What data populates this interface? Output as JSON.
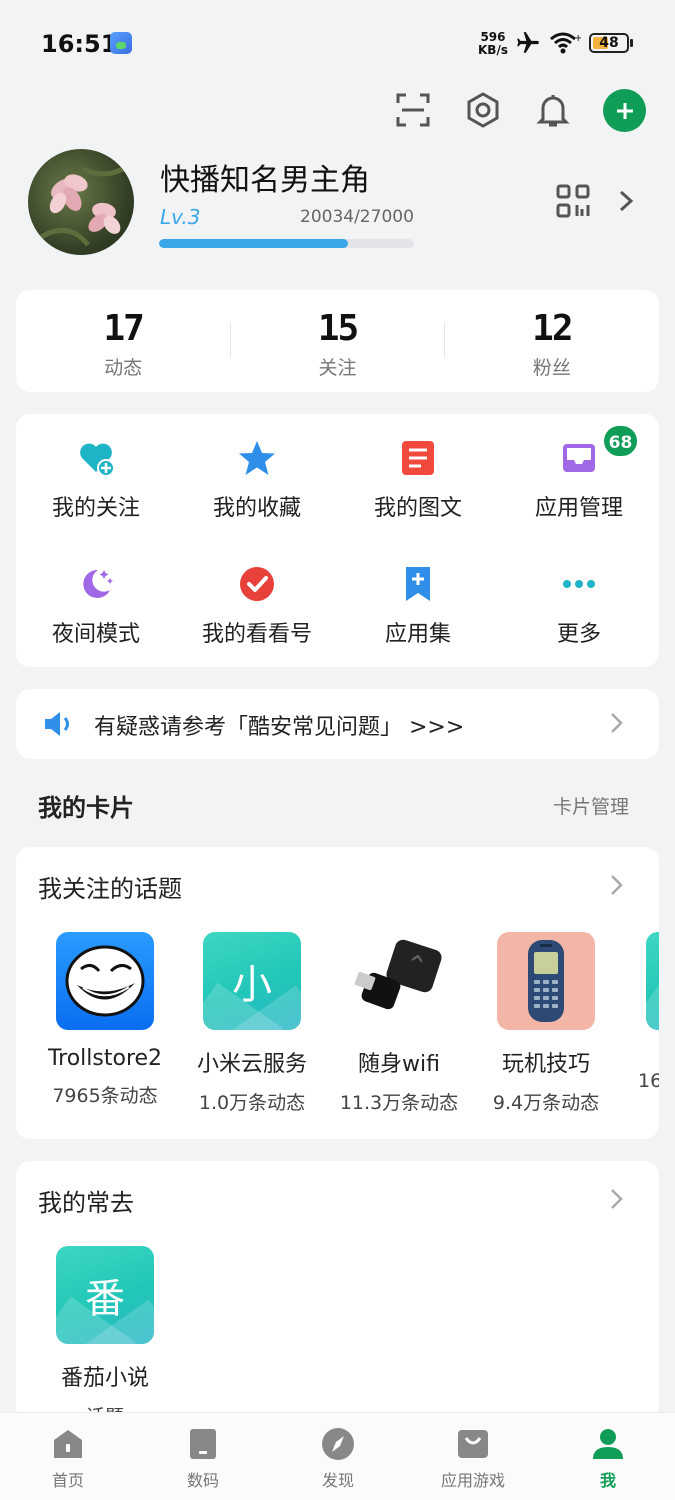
{
  "status_bar": {
    "time": "16:51",
    "net_speed_value": "596",
    "net_speed_unit": "KB/s",
    "battery": "48",
    "icons": [
      "app-icon",
      "airplane-icon",
      "wifi-icon",
      "battery-icon"
    ]
  },
  "top_icons": [
    "scan-icon",
    "settings-icon",
    "bell-icon",
    "plus-icon"
  ],
  "profile": {
    "username": "快播知名男主角",
    "level": "Lv.3",
    "exp": "20034/27000",
    "exp_progress": 0.742
  },
  "stats": [
    {
      "value": "17",
      "label": "动态"
    },
    {
      "value": "15",
      "label": "关注"
    },
    {
      "value": "12",
      "label": "粉丝"
    }
  ],
  "grid": [
    {
      "label": "我的关注",
      "icon": "heart-plus-icon",
      "color": "#1fb5c6"
    },
    {
      "label": "我的收藏",
      "icon": "star-icon",
      "color": "#2f8fe8"
    },
    {
      "label": "我的图文",
      "icon": "document-icon",
      "color": "#ef4a3c"
    },
    {
      "label": "应用管理",
      "icon": "inbox-icon",
      "color": "#a067e6"
    },
    {
      "label": "夜间模式",
      "icon": "moon-icon",
      "color": "#a067e6"
    },
    {
      "label": "我的看看号",
      "icon": "check-circle-icon",
      "color": "#e8403a"
    },
    {
      "label": "应用集",
      "icon": "bookmark-plus-icon",
      "color": "#2f8fe8"
    },
    {
      "label": "更多",
      "icon": "more-icon",
      "color": "#1fb5c6"
    }
  ],
  "app_manage_badge": "68",
  "notice": {
    "text": "有疑惑请参考「酷安常见问题」 >>>",
    "icon": "speaker-icon"
  },
  "cards_section": {
    "title": "我的卡片",
    "action": "卡片管理"
  },
  "followed_topics": {
    "title": "我关注的话题",
    "items": [
      {
        "name": "Trollstore2",
        "count": "7965条动态",
        "tile": "trollface"
      },
      {
        "name": "小米云服务",
        "count": "1.0万条动态",
        "tile_char": "小"
      },
      {
        "name": "随身wifi",
        "count": "11.3万条动态",
        "tile": "usb-wifi"
      },
      {
        "name": "玩机技巧",
        "count": "9.4万条动态",
        "tile": "phone"
      },
      {
        "name": "",
        "count": "16",
        "tile": "teal"
      }
    ]
  },
  "frequent": {
    "title": "我的常去",
    "items": [
      {
        "name": "番茄小说",
        "tile_char": "番",
        "sub": "话题"
      }
    ]
  },
  "bottom_nav": [
    {
      "label": "首页",
      "icon": "home-icon"
    },
    {
      "label": "数码",
      "icon": "device-icon"
    },
    {
      "label": "发现",
      "icon": "compass-icon"
    },
    {
      "label": "应用游戏",
      "icon": "bag-icon"
    },
    {
      "label": "我",
      "icon": "person-icon",
      "active": true
    }
  ],
  "colors": {
    "accent": "#109d58",
    "level_blue": "#3aa7e8",
    "background": "#f2f3f5"
  }
}
